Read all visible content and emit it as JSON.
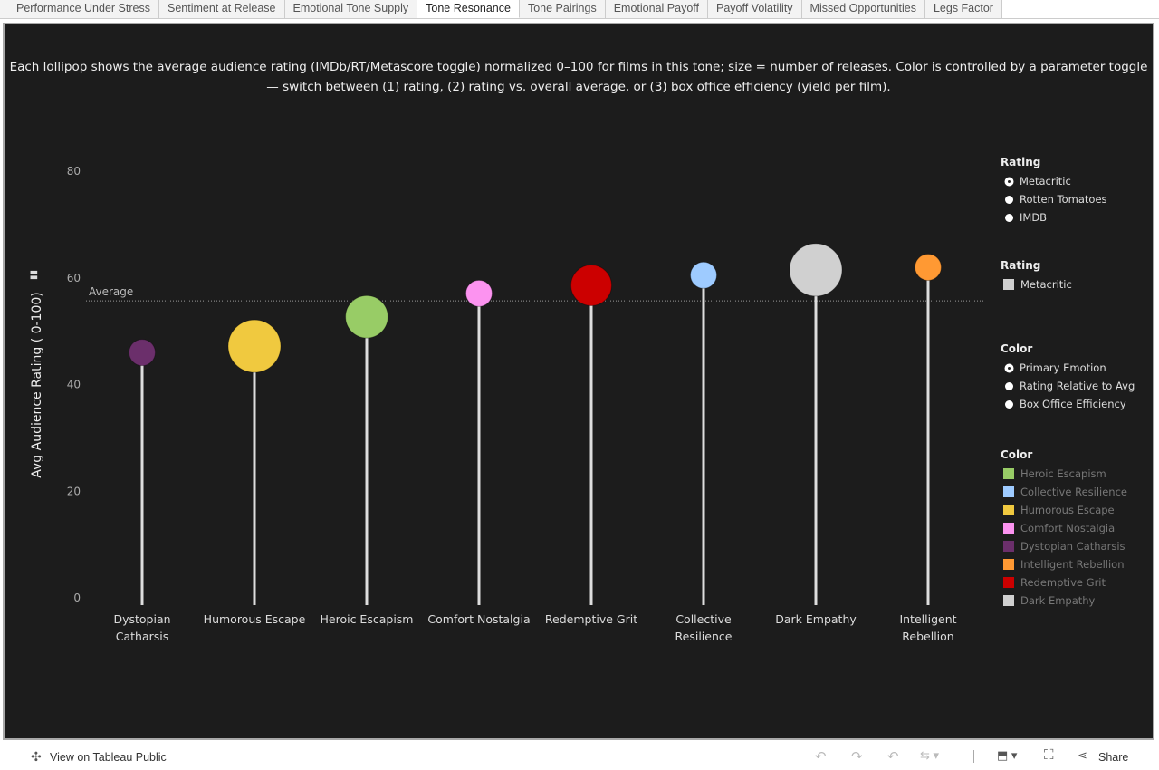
{
  "tabs": [
    "Performance Under Stress",
    "Sentiment at Release",
    "Emotional Tone Supply",
    "Tone Resonance",
    "Tone Pairings",
    "Emotional Payoff",
    "Payoff Volatility",
    "Missed Opportunities",
    "Legs Factor"
  ],
  "active_tab": 3,
  "description": "Each lollipop shows the average audience rating (IMDb/RT/Metascore toggle) normalized 0–100 for films in this tone; size = number of releases. Color is controlled by a parameter toggle — switch between (1) rating, (2) rating vs. overall average, or (3) box office efficiency (yield per film).",
  "chart_data": {
    "type": "scatter",
    "subtype": "lollipop",
    "ylabel": "Avg Audience Rating ( 0-100)",
    "ylim": [
      0,
      80
    ],
    "yticks": [
      0,
      20,
      40,
      60,
      80
    ],
    "reference_line": {
      "label": "Average",
      "value": 55.7
    },
    "categories": [
      "Dystopian Catharsis",
      "Humorous Escape",
      "Heroic Escapism",
      "Comfort Nostalgia",
      "Redemptive Grit",
      "Collective Resilience",
      "Dark Empathy",
      "Intelligent Rebellion"
    ],
    "category_labels": [
      [
        "Dystopian",
        "Catharsis"
      ],
      [
        "Humorous Escape"
      ],
      [
        "Heroic Escapism"
      ],
      [
        "Comfort Nostalgia"
      ],
      [
        "Redemptive Grit"
      ],
      [
        "Collective",
        "Resilience"
      ],
      [
        "Dark Empathy"
      ],
      [
        "Intelligent",
        "Rebellion"
      ]
    ],
    "values": [
      46.0,
      47.2,
      52.7,
      57.1,
      58.6,
      60.5,
      61.5,
      62.0
    ],
    "relative_size": [
      1,
      4,
      2.6,
      1,
      2.4,
      1,
      4,
      1
    ],
    "colors": [
      "#6b2f6b",
      "#f0c93f",
      "#98cc66",
      "#fc93f0",
      "#cc0000",
      "#9ecbff",
      "#d0d0d0",
      "#ff9933"
    ]
  },
  "legends": {
    "rating_param": {
      "title": "Rating",
      "options": [
        "Metacritic",
        "Rotten Tomatoes",
        "IMDB"
      ],
      "selected": 0
    },
    "rating_legend": {
      "title": "Rating",
      "items": [
        "Metacritic"
      ],
      "color": "#d0d0d0"
    },
    "color_param": {
      "title": "Color",
      "options": [
        "Primary Emotion",
        "Rating Relative to Avg",
        "Box Office Efficiency"
      ],
      "selected": 0
    },
    "color_legend": {
      "title": "Color",
      "items": [
        {
          "label": "Heroic Escapism",
          "color": "#98cc66"
        },
        {
          "label": "Collective Resilience",
          "color": "#9ecbff"
        },
        {
          "label": "Humorous Escape",
          "color": "#f0c93f"
        },
        {
          "label": "Comfort Nostalgia",
          "color": "#fc93f0"
        },
        {
          "label": "Dystopian Catharsis",
          "color": "#6b2f6b"
        },
        {
          "label": "Intelligent Rebellion",
          "color": "#ff9933"
        },
        {
          "label": "Redemptive Grit",
          "color": "#cc0000"
        },
        {
          "label": "Dark Empathy",
          "color": "#d0d0d0"
        }
      ]
    }
  },
  "footer": {
    "view_label": "View on Tableau Public",
    "share_label": "Share"
  }
}
